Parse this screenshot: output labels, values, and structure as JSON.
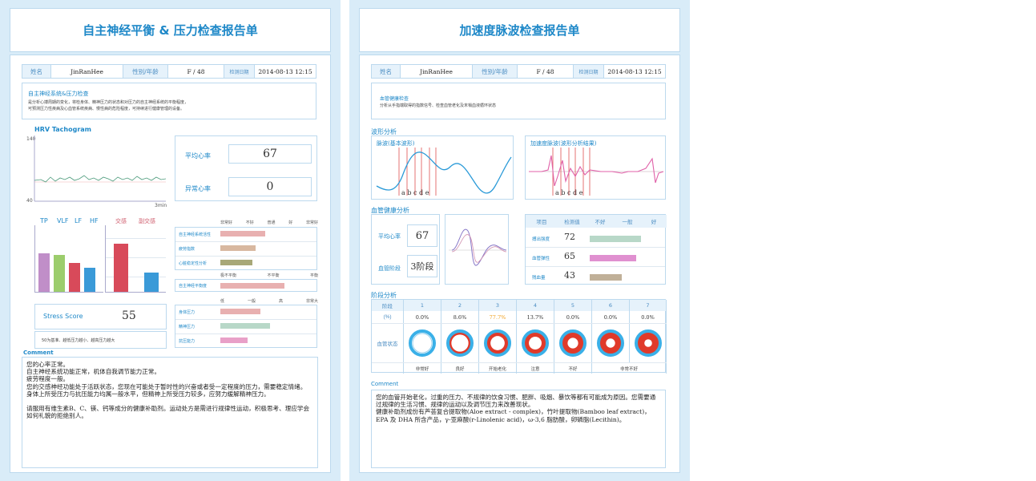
{
  "left": {
    "title": "自主神经平衡 & 压力检查报告单",
    "info": {
      "name_label": "姓名",
      "name": "JinRanHee",
      "sex_label": "性别/年龄",
      "sex": "F / 48",
      "date_label": "检测日期",
      "date": "2014-08-13 12:15"
    },
    "desc_title": "自主神经系统&压力检查",
    "desc_line1": "是分析心搏周期的变化，将检身体、精神压力的状态和对压力的自主神经系统的平衡程度，",
    "desc_line2": "可预测压力性疾病及心血管系统疾病、慢性病的危险程度，可持续进行健康管理的设备。",
    "hrv_title": "HRV Tachogram",
    "hrv_ymax": "140",
    "hrv_ymin": "40",
    "hrv_x": "3min",
    "avg_hr_label": "平均心率",
    "avg_hr": "67",
    "abn_hr_label": "异常心率",
    "abn_hr": "0",
    "freq_labels": [
      "TP",
      "VLF",
      "LF",
      "HF"
    ],
    "symp_label": "交感",
    "para_label": "副交感",
    "ans_scale": [
      "非常好",
      "不好",
      "普通",
      "好",
      "非常好"
    ],
    "ans_rows": [
      "自主神经系统活性",
      "疲劳指数",
      "心脏稳定性分析"
    ],
    "bal_scale": [
      "极不平衡",
      "不平衡",
      "平衡"
    ],
    "bal_row": "自主神经平衡度",
    "stress_scale": [
      "低",
      "一般",
      "高",
      "非常大"
    ],
    "stress_rows": [
      "身体压力",
      "精神压力",
      "抗压能力"
    ],
    "stress_title": "Stress Score",
    "stress_value": "55",
    "stress_note": "50为基准、越低压力越小、越高压力越大",
    "comment_title": "Comment",
    "comment": "您的心率正常。\n自主神经系统功能正常，机体自我调节能力正常。\n疲劳程度一般。\n您的交感神经功能处于活跃状态，您现在可能处于暂时性的兴奋或者受一定程度的压力，需要稳定情绪。\n身体上所受压力与抗压能力均属一般水平，但精神上所受压力较多，应努力缓解精神压力。\n\n请服用有维生素B、C、镁、钙等成分的健康补助剂。运动处方是需进行规律性运动，积极思考、理应学会如何礼貌的拒绝别人。"
  },
  "right": {
    "title": "加速度脉波检查报告单",
    "info": {
      "name_label": "姓名",
      "name": "JinRanHee",
      "sex_label": "性别/年龄",
      "sex": "F / 48",
      "date_label": "检测日期",
      "date": "2014-08-13 12:15"
    },
    "desc_title": "血管健康检查",
    "desc_line1": "分析从手指端取得的指数信号、检查血管老化及末梢血液循环状态",
    "wave_title": "波形分析",
    "wave1_label": "脉波(基本波形)",
    "wave2_label": "加速度脉波(波形分析结果)",
    "wave_marks": [
      "a",
      "b",
      "c",
      "d",
      "e"
    ],
    "vh_title": "血管健康分析",
    "avg_hr_label": "平均心率",
    "avg_hr": "67",
    "stage_label": "血管阶段",
    "stage": "3阶段",
    "tbl_head": [
      "项目",
      "检测值",
      "不好",
      "一般",
      "好"
    ],
    "tbl_rows": [
      {
        "name": "搏出强度",
        "value": "72"
      },
      {
        "name": "血管弹性",
        "value": "65"
      },
      {
        "name": "残血量",
        "value": "43"
      }
    ],
    "stage_title": "阶段分析",
    "stage_head": [
      "阶段",
      "1",
      "2",
      "3",
      "4",
      "5",
      "6",
      "7"
    ],
    "stage_pct_label": "(%)",
    "stage_pct": [
      "0.0%",
      "8.6%",
      "77.7%",
      "13.7%",
      "0.0%",
      "0.0%",
      "0.0%"
    ],
    "vessel_label": "血管状态",
    "stage_words": [
      "非常好",
      "良好",
      "开始老化",
      "注意",
      "不好",
      "非常不好"
    ],
    "comment_title": "Comment",
    "comment": "您的血管开始老化，过重的压力、不规律的饮食习惯、肥胖、吸烟、暴饮等都有可能成为原因。您需要通过规律的生活习惯、规律的运动以及调节压力来改善现状。\n健康补助剂成份有芦荟复合提取物(Aloe extract - complex)，竹叶提取物(Bamboo leaf extract)，EPA 及 DHA 所含产品，γ-亚麻酸(r-Linolenic acid)，ω-3,6 脂肪酸，卵磷脂(Lecithin)。"
  },
  "colors": {
    "accent": "#1e88c8",
    "border": "#bcd9ee",
    "panel": "#d9ecf8"
  }
}
